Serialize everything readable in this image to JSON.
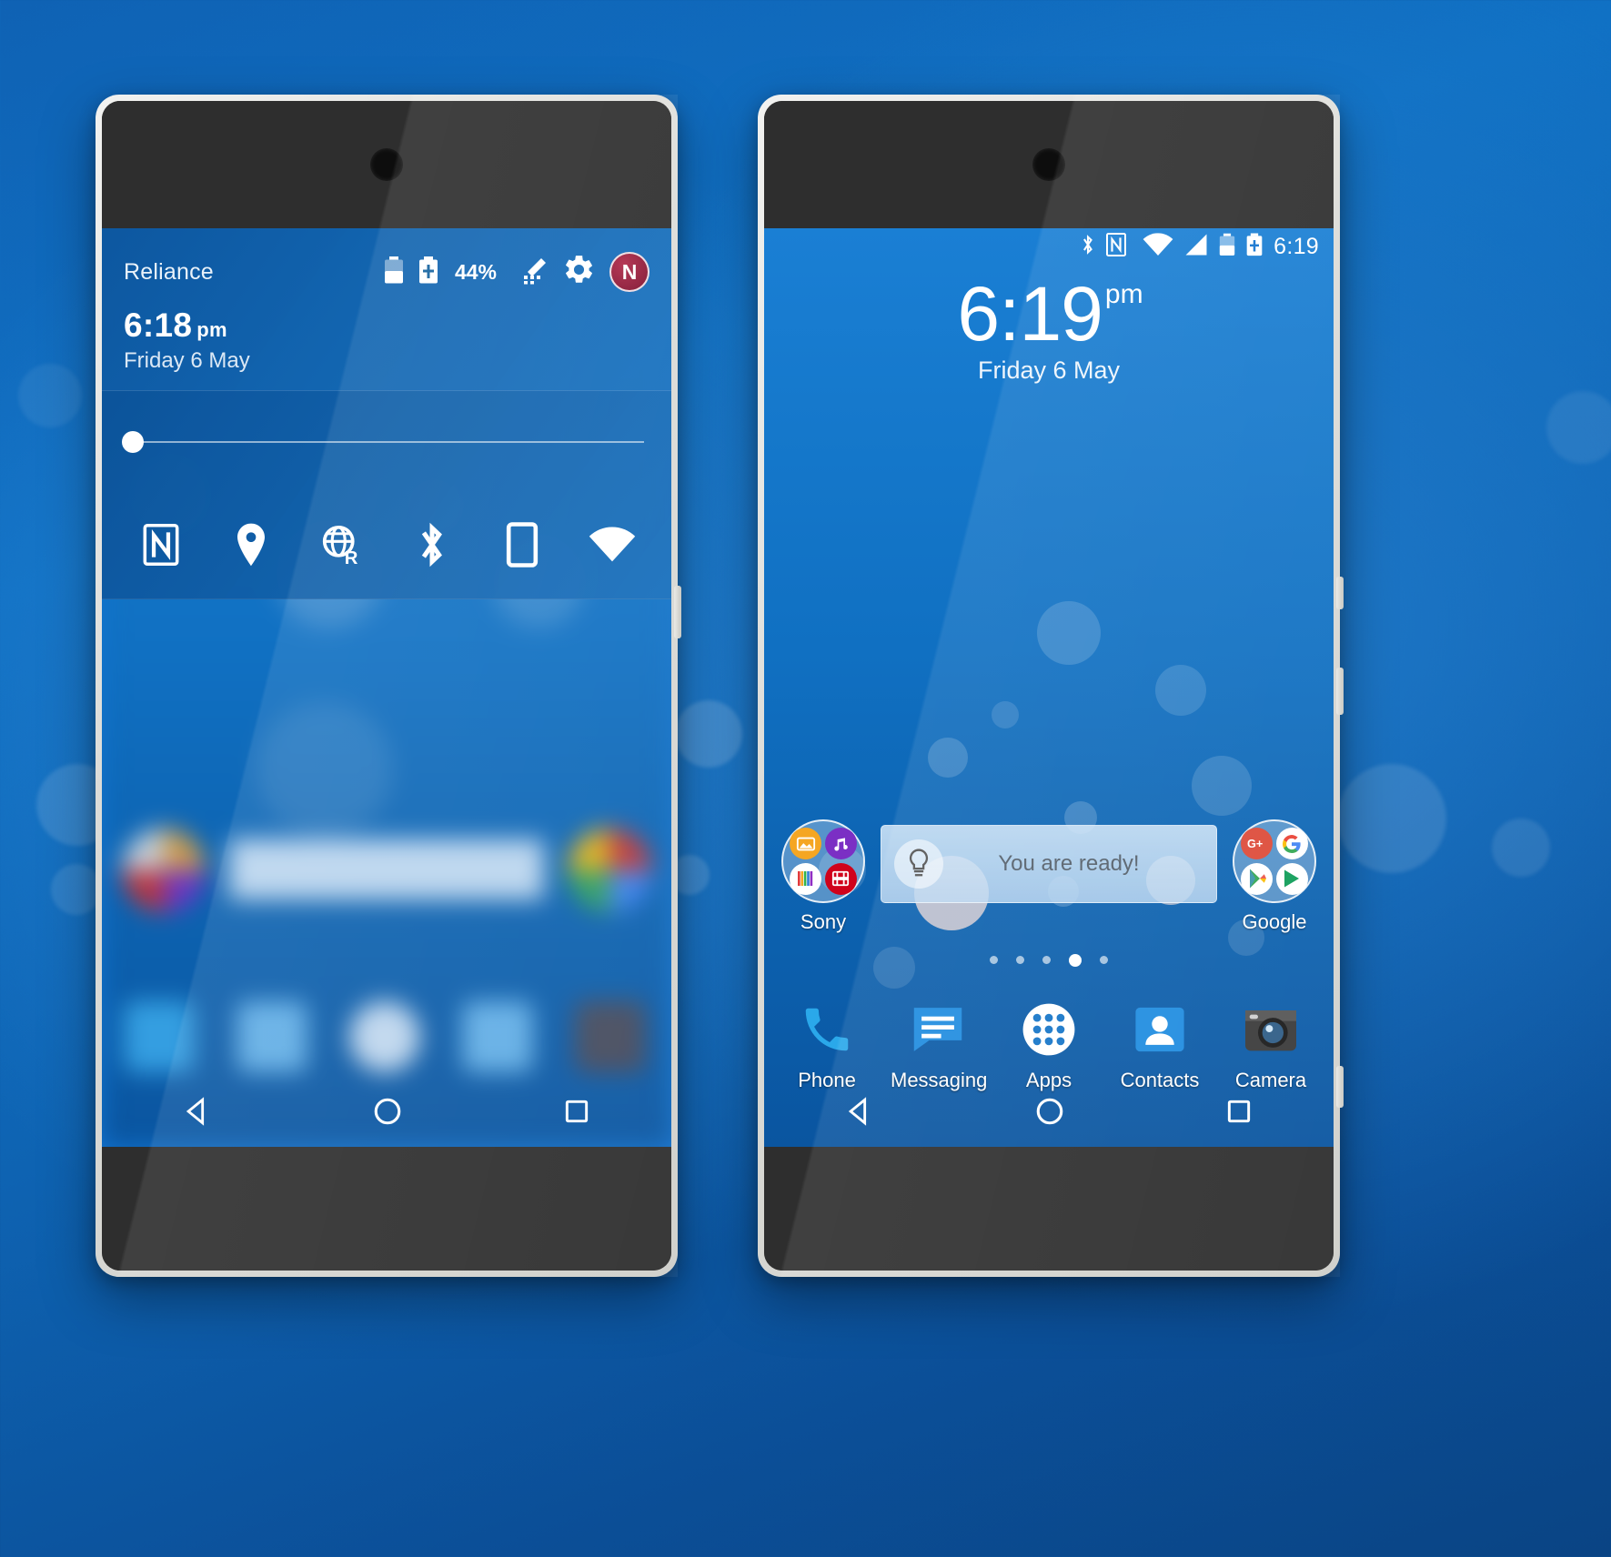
{
  "scene": {
    "background_color": "#0f62b4",
    "description": "Two Android phones on blue bokeh wallpaper"
  },
  "left_phone": {
    "name": "notification-shade",
    "shade": {
      "carrier": "Reliance",
      "battery_percent": "44%",
      "icons": [
        "battery-icon",
        "stamina-battery-icon",
        "edit-icon",
        "settings-gear-icon",
        "nova-launcher-icon"
      ],
      "nova_badge_letter": "N",
      "clock": "6:18",
      "clock_ampm": "pm",
      "date": "Friday 6 May",
      "brightness_value": 2
    },
    "quick_settings": [
      {
        "name": "nfc-toggle",
        "label": "NFC",
        "icon": "nfc-icon"
      },
      {
        "name": "location-toggle",
        "label": "Location",
        "icon": "location-pin-icon"
      },
      {
        "name": "roaming-data-toggle",
        "label": "Mobile data roaming",
        "icon": "globe-roaming-icon"
      },
      {
        "name": "bluetooth-toggle",
        "label": "Bluetooth",
        "icon": "bluetooth-icon"
      },
      {
        "name": "rotation-toggle",
        "label": "Auto-rotate",
        "icon": "device-rotate-icon"
      },
      {
        "name": "wifi-toggle",
        "label": "Wi-Fi",
        "icon": "wifi-icon"
      }
    ],
    "navigation": [
      {
        "name": "back-button",
        "icon": "triangle-back-icon"
      },
      {
        "name": "home-button",
        "icon": "circle-home-icon"
      },
      {
        "name": "recents-button",
        "icon": "square-recents-icon"
      }
    ]
  },
  "right_phone": {
    "name": "home-screen",
    "status_bar": {
      "icons": [
        "bluetooth-icon",
        "nfc-icon",
        "wifi-icon",
        "signal-icon",
        "battery-icon",
        "stamina-battery-icon"
      ],
      "time": "6:19"
    },
    "clock_widget": {
      "time": "6:19",
      "ampm": "pm",
      "date": "Friday 6 May"
    },
    "folders": [
      {
        "name": "sony-folder",
        "label": "Sony",
        "apps": [
          "album-icon",
          "music-icon",
          "what-s-new-icon",
          "movies-icon"
        ]
      },
      {
        "name": "google-folder",
        "label": "Google",
        "apps": [
          "google-plus-icon",
          "google-search-icon",
          "play-store-icon",
          "play-music-icon"
        ]
      }
    ],
    "ready_widget": {
      "name": "xperia-lounge-tip-widget",
      "text": "You are ready!",
      "icon": "lightbulb-icon"
    },
    "page_dots": {
      "count": 5,
      "active_index": 3
    },
    "dock": [
      {
        "name": "phone-app",
        "label": "Phone",
        "icon": "phone-handset-icon",
        "color": "#1aa3e8"
      },
      {
        "name": "messaging-app",
        "label": "Messaging",
        "icon": "message-bubble-icon",
        "color": "#1f8ce0"
      },
      {
        "name": "apps-drawer",
        "label": "Apps",
        "icon": "app-grid-icon",
        "color": "#ffffff"
      },
      {
        "name": "contacts-app",
        "label": "Contacts",
        "icon": "contacts-person-icon",
        "color": "#1f8ce0"
      },
      {
        "name": "camera-app",
        "label": "Camera",
        "icon": "camera-lens-icon",
        "color": "#2b2b2b"
      }
    ],
    "navigation": [
      {
        "name": "back-button",
        "icon": "triangle-back-icon"
      },
      {
        "name": "home-button",
        "icon": "circle-home-icon"
      },
      {
        "name": "recents-button",
        "icon": "square-recents-icon"
      }
    ]
  }
}
